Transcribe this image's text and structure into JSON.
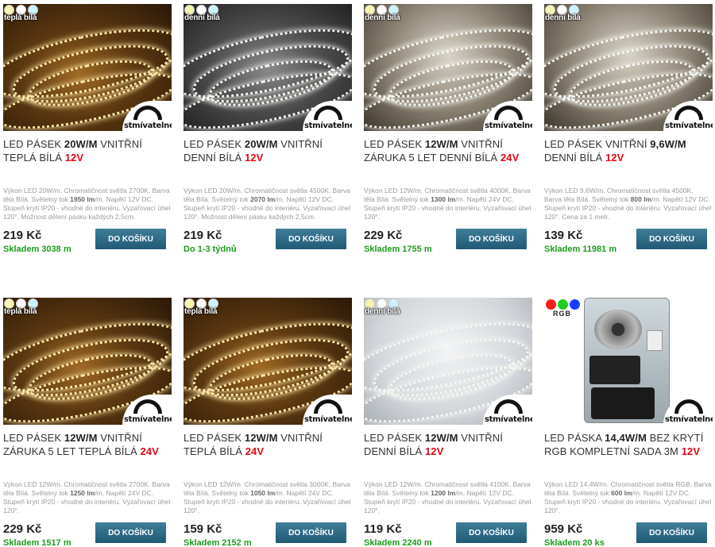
{
  "products": [
    {
      "badge_label": "teplá bílá",
      "badge_dots": [
        "#f7f3b0",
        "#ffffff",
        "#cdf3ff"
      ],
      "dimmable_label": "stmívatelné",
      "name_pre": "LED PÁSEK ",
      "name_bold": "20W/M",
      "name_post": " VNITŘNÍ TEPLÁ BÍLÁ ",
      "voltage": "12V",
      "desc_pre": "Výkon LED 20W/m. Chromatičnost světla 2700K. Barva těla Bílá. Světelný tok ",
      "desc_lm": "1950 lm",
      "desc_post": "/m. Napětí 12V DC. Stupeň krytí IP20 - vhodné do interiéru. Vyzařovací úhel 120°. Možnost dělení pásku každých 2,5cm.",
      "price": "219 Kč",
      "button": "DO KOŠÍKU",
      "stock": "Skladem 3038 m",
      "stock_color": "#1e9a1e"
    },
    {
      "badge_label": "denní bílá",
      "badge_dots": [
        "#f7f3b0",
        "#ffffff",
        "#cdf3ff"
      ],
      "dimmable_label": "stmívatelné",
      "name_pre": "LED PÁSEK ",
      "name_bold": "20W/M",
      "name_post": " VNITŘNÍ DENNÍ BÍLÁ ",
      "voltage": "12V",
      "desc_pre": "Výkon LED 20W/m. Chromatičnost světla 4500K. Barva těla Bílá. Světelný tok ",
      "desc_lm": "2070 lm",
      "desc_post": "/m. Napětí 12V DC. Stupeň krytí IP20 - vhodné do interiéru. Vyzařovací úhel 120°. Možnost dělení pásku každých 2,5cm.",
      "price": "219 Kč",
      "button": "DO KOŠÍKU",
      "stock": "Do 1-3 týdnů",
      "stock_color": "#1e9a1e"
    },
    {
      "badge_label": "denní bílá",
      "badge_dots": [
        "#f7f3b0",
        "#ffffff",
        "#cdf3ff"
      ],
      "dimmable_label": "stmívatelné",
      "name_pre": "LED PÁSEK ",
      "name_bold": "12W/M",
      "name_post": " VNITŘNÍ ZÁRUKA 5 LET DENNÍ BÍLÁ ",
      "voltage": "24V",
      "desc_pre": "Výkon LED 12W/m. Chromatičnost světla 4000K. Barva těla Bílá. Světelný tok ",
      "desc_lm": "1300 lm",
      "desc_post": "/m. Napětí 24V DC. Stupeň krytí IP20 - vhodné do interiéru. Vyzařovací úhel 120°.",
      "price": "229 Kč",
      "button": "DO KOŠÍKU",
      "stock": "Skladem 1755 m",
      "stock_color": "#1e9a1e"
    },
    {
      "badge_label": "denní bílá",
      "badge_dots": [
        "#f7f3b0",
        "#ffffff",
        "#cdf3ff"
      ],
      "dimmable_label": "stmívatelné",
      "name_pre": "LED PÁSEK VNITŘNÍ ",
      "name_bold": "9,6W/M",
      "name_post": " DENNÍ BÍLÁ ",
      "voltage": "12V",
      "desc_pre": "Výkon LED 9,6W/m. Chromatičnost světla 4500K. Barva těla Bílá. Světelný tok ",
      "desc_lm": "800 lm",
      "desc_post": "/m. Napětí 12V DC. Stupeň krytí IP20 - vhodné do interiéru. Vyzařovací úhel 120°. Cena za 1 metr.",
      "price": "139 Kč",
      "button": "DO KOŠÍKU",
      "stock": "Skladem 11981 m",
      "stock_color": "#1e9a1e"
    },
    {
      "badge_label": "teplá bílá",
      "badge_dots": [
        "#f7f3b0",
        "#ffffff",
        "#cdf3ff"
      ],
      "dimmable_label": "stmívatelné",
      "name_pre": "LED PÁSEK ",
      "name_bold": "12W/M",
      "name_post": " VNITŘNÍ ZÁRUKA 5 LET TEPLÁ BÍLÁ ",
      "voltage": "24V",
      "desc_pre": "Výkon LED 12W/m. Chromatičnost světla 2700K. Barva těla Bílá. Světelný tok ",
      "desc_lm": "1250 lm",
      "desc_post": "/m. Napětí 24V DC. Stupeň krytí IP20 - vhodné do interiéru. Vyzařovací úhel 120°.",
      "price": "229 Kč",
      "button": "DO KOŠÍKU",
      "stock": "Skladem 1517 m",
      "stock_color": "#1e9a1e"
    },
    {
      "badge_label": "teplá bílá",
      "badge_dots": [
        "#f7f3b0",
        "#ffffff",
        "#cdf3ff"
      ],
      "dimmable_label": "stmívatelné",
      "name_pre": "LED PÁSEK ",
      "name_bold": "12W/M",
      "name_post": " VNITŘNÍ TEPLÁ BÍLÁ ",
      "voltage": "24V",
      "desc_pre": "Výkon LED 12W/m. Chromatičnost světla 3000K. Barva těla Bílá. Světelný tok ",
      "desc_lm": "1050 lm",
      "desc_post": "/m. Napětí 24V DC. Stupeň krytí IP20 - vhodné do interiéru. Vyzařovací úhel 120°.",
      "price": "159 Kč",
      "button": "DO KOŠÍKU",
      "stock": "Skladem 2152 m",
      "stock_color": "#1e9a1e"
    },
    {
      "badge_label": "denní bílá",
      "badge_dots": [
        "#f7f3b0",
        "#ffffff",
        "#cdf3ff"
      ],
      "dimmable_label": "stmívatelné",
      "name_pre": "LED PÁSEK ",
      "name_bold": "12W/M",
      "name_post": " VNITŘNÍ DENNÍ BÍLÁ ",
      "voltage": "12V",
      "desc_pre": "Výkon LED 12W/m. Chromatičnost světla 4100K. Barva těla Bílá. Světelný tok ",
      "desc_lm": "1200 lm",
      "desc_post": "/m. Napětí 12V DC. Stupeň krytí IP20 - vhodné do interiéru. Vyzařovací úhel 120°.",
      "price": "119 Kč",
      "button": "DO KOŠÍKU",
      "stock": "Skladem 2240 m",
      "stock_color": "#1e9a1e"
    },
    {
      "badge_label": "RGB",
      "badge_dots": [
        "#ff1a1a",
        "#22cc22",
        "#1a3cff"
      ],
      "dimmable_label": "stmívatelné",
      "name_pre": "LED PÁSKA ",
      "name_bold": "14,4W/M",
      "name_post": " BEZ KRYTÍ RGB KOMPLETNÍ SADA 3M ",
      "voltage": "12V",
      "desc_pre": "Výkon LED 14,4W/m. Chromatičnost světla RGB. Barva těla Bílá. Světelný tok ",
      "desc_lm": "600 lm",
      "desc_post": "/m. Napětí 12V DC. Stupeň krytí IP20 - vhodné do interiéru. Vyzařovací úhel 120°.",
      "price": "959 Kč",
      "button": "DO KOŠÍKU",
      "stock": "Skladem 20 ks",
      "stock_color": "#1e9a1e"
    }
  ]
}
